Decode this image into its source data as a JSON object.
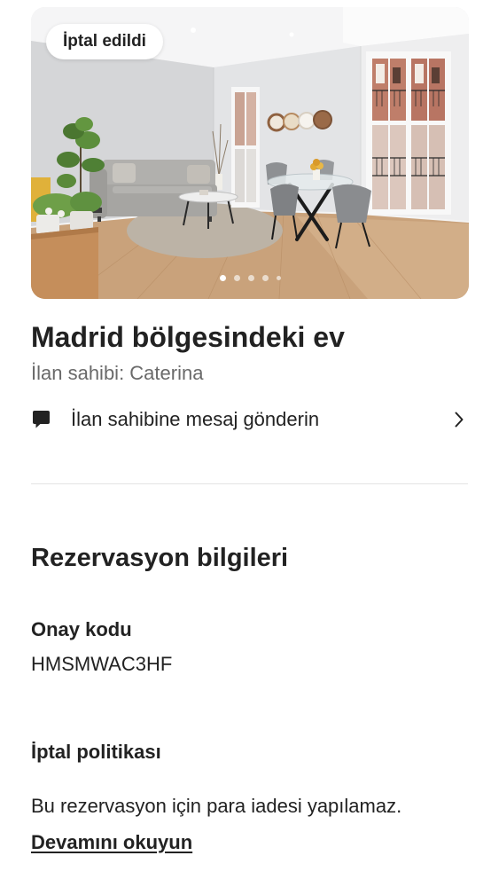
{
  "listing": {
    "photo": {
      "status_badge": "İptal edildi",
      "carousel": {
        "dot_count": 5,
        "active_index": 0
      }
    },
    "title": "Madrid bölgesindeki ev",
    "host_line": "İlan sahibi: Caterina"
  },
  "message_host": {
    "label": "İlan sahibine mesaj gönderin",
    "icon": "chat-bubble-icon",
    "trailing_icon": "chevron-right-icon"
  },
  "reservation": {
    "heading": "Rezervasyon bilgileri",
    "confirmation": {
      "label": "Onay kodu",
      "value": "HMSMWAC3HF"
    },
    "cancellation": {
      "label": "İptal politikası",
      "text": "Bu rezervasyon için para iadesi yapılamaz.",
      "link": "Devamını okuyun"
    }
  },
  "colors": {
    "text_primary": "#222222",
    "text_secondary": "#6a6a6a",
    "divider": "#e3e3e3",
    "badge_background": "#ffffff"
  }
}
